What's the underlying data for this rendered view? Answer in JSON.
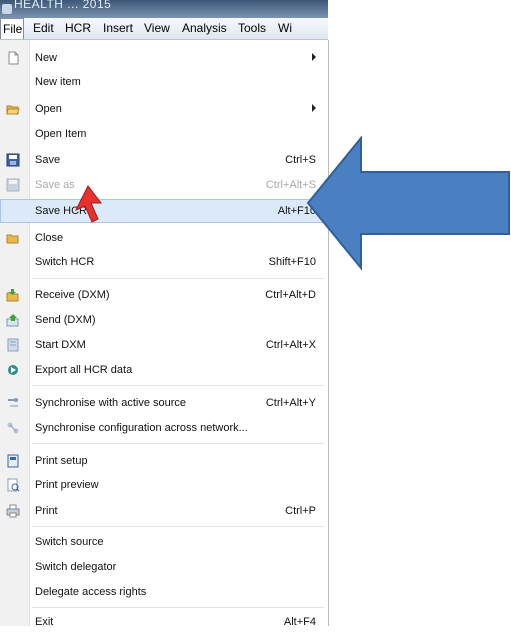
{
  "window": {
    "title": "HEALTH ... 2015"
  },
  "menubar": {
    "items": [
      {
        "label": "File",
        "active": true
      },
      {
        "label": "Edit"
      },
      {
        "label": "HCR"
      },
      {
        "label": "Insert"
      },
      {
        "label": "View"
      },
      {
        "label": "Analysis"
      },
      {
        "label": "Tools"
      },
      {
        "label": "Wi"
      }
    ]
  },
  "file_menu": {
    "items": [
      {
        "label": "New",
        "submenu": true,
        "icon": "new-document-icon"
      },
      {
        "label": "New item"
      },
      {
        "label": "Open",
        "submenu": true,
        "icon": "folder-open-icon"
      },
      {
        "label": "Open Item"
      },
      {
        "label": "Save",
        "shortcut": "Ctrl+S",
        "icon": "save-disk-icon"
      },
      {
        "label": "Save as",
        "shortcut": "Ctrl+Alt+S",
        "disabled": true,
        "icon": "save-as-icon"
      },
      {
        "label": "Save HCR",
        "shortcut": "Alt+F10",
        "highlighted": true
      },
      {
        "label": "Close",
        "icon": "close-folder-icon"
      },
      {
        "label": "Switch HCR",
        "shortcut": "Shift+F10"
      },
      {
        "label": "Receive (DXM)",
        "shortcut": "Ctrl+Alt+D",
        "icon": "receive-icon"
      },
      {
        "label": "Send (DXM)",
        "icon": "send-icon"
      },
      {
        "label": "Start DXM",
        "shortcut": "Ctrl+Alt+X",
        "icon": "start-dxm-icon"
      },
      {
        "label": "Export all HCR data",
        "icon": "export-icon"
      },
      {
        "label": "Synchronise with active source",
        "shortcut": "Ctrl+Alt+Y",
        "icon": "sync-icon"
      },
      {
        "label": "Synchronise configuration across network...",
        "icon": "network-sync-icon"
      },
      {
        "label": "Print setup",
        "icon": "print-setup-icon"
      },
      {
        "label": "Print preview",
        "icon": "print-preview-icon"
      },
      {
        "label": "Print",
        "shortcut": "Ctrl+P",
        "icon": "printer-icon"
      },
      {
        "label": "Switch source"
      },
      {
        "label": "Switch delegator"
      },
      {
        "label": "Delegate access rights"
      },
      {
        "label": "Exit",
        "shortcut": "Alt+F4"
      }
    ]
  },
  "annotation": {
    "arrow_color": "#4a7fc1",
    "cursor_color": "#e8302f"
  }
}
